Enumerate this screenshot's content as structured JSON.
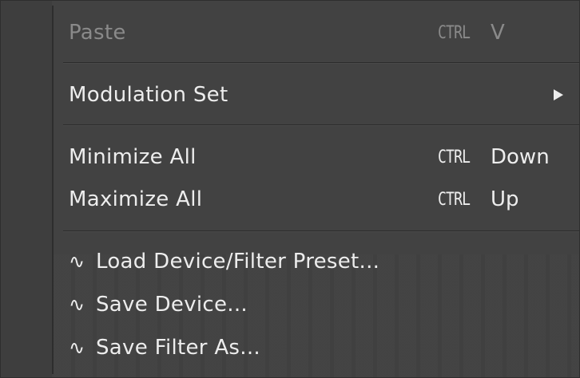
{
  "menu": {
    "items": {
      "paste": {
        "label": "Paste",
        "ctrl": "CTRL",
        "key": "V"
      },
      "modulation_set": {
        "label": "Modulation Set"
      },
      "minimize_all": {
        "label": "Minimize All",
        "ctrl": "CTRL",
        "key": "Down"
      },
      "maximize_all": {
        "label": "Maximize All",
        "ctrl": "CTRL",
        "key": "Up"
      },
      "load_preset": {
        "icon": "∿",
        "label": "Load Device/Filter Preset..."
      },
      "save_device": {
        "icon": "∿",
        "label": "Save Device..."
      },
      "save_filter": {
        "icon": "∿",
        "label": "Save Filter As..."
      }
    },
    "icons": {
      "submenu": "chevron-right-icon",
      "preset": "wave-icon"
    },
    "colors": {
      "background": "#424242",
      "text": "#ededed",
      "disabled_text": "#8a8a8a",
      "separator": "#2c2c2c"
    }
  }
}
